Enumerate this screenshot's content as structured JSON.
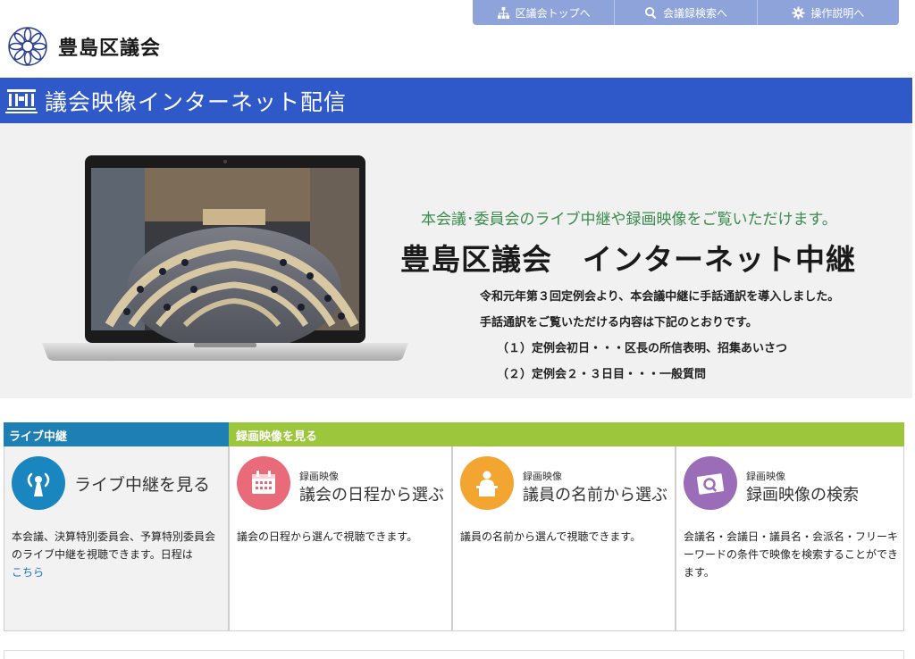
{
  "topnav": {
    "items": [
      {
        "label": "区議会トップへ",
        "icon": "sitemap-icon"
      },
      {
        "label": "会議録検索へ",
        "icon": "search-icon"
      },
      {
        "label": "操作説明へ",
        "icon": "gear-icon"
      }
    ]
  },
  "logo": {
    "text": "豊島区議会",
    "icon": "chrysanthemum-emblem-icon"
  },
  "title_bar": {
    "title": "議会映像インターネット配信",
    "icon": "assembly-hall-icon"
  },
  "hero": {
    "subtitle": "本会議･委員会のライブ中継や録画映像をご覧いただけます。",
    "title": "豊島区議会　インターネット中継",
    "lines": [
      "令和元年第３回定例会より、本会議中継に手話通訳を導入しました。",
      "手話通訳をご覧いただける内容は下記のとおりです。",
      "（１）定例会初日・・・区長の所信表明、招集あいさつ",
      "（２）定例会２・３日目・・・一般質問"
    ]
  },
  "categories": {
    "live": "ライブ中継",
    "recorded": "録画映像を見る"
  },
  "cards": {
    "live": {
      "title": "ライブ中継を見る",
      "desc": "本会議、決算特別委員会、予算特別委員会のライブ中継を視聴できます。日程は",
      "link": "こちら",
      "color": "#1a86bf",
      "icon": "broadcast-tower-icon"
    },
    "schedule": {
      "small": "録画映像",
      "title": "議会の日程から選ぶ",
      "desc": "議会の日程から選んで視聴できます。",
      "color": "#e96a78",
      "icon": "calendar-icon"
    },
    "member": {
      "small": "録画映像",
      "title": "議員の名前から選ぶ",
      "desc": "議員の名前から選んで視聴できます。",
      "color": "#f2a531",
      "icon": "speaker-podium-icon"
    },
    "search": {
      "small": "録画映像",
      "title": "録画映像の検索",
      "desc": "会議名・会議日・議員名・会派名・フリーキーワードの条件で映像を検索することができます。",
      "color": "#9b6cb8",
      "icon": "video-search-icon"
    }
  }
}
